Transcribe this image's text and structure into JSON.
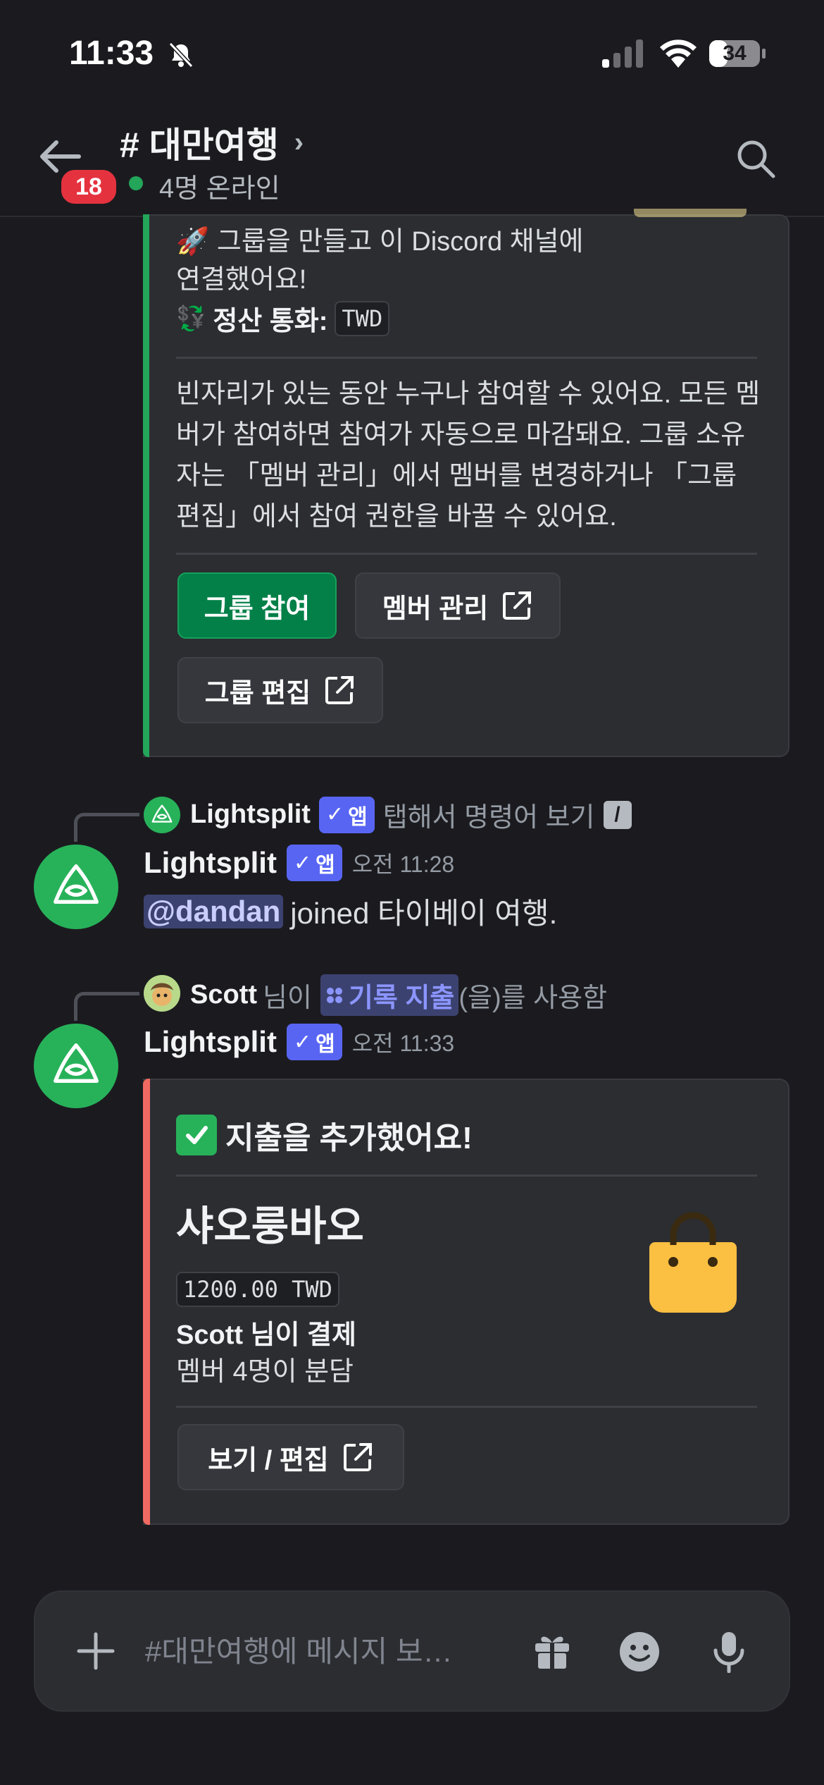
{
  "status_bar": {
    "time": "11:33",
    "battery": "34"
  },
  "header": {
    "channel_title": "# 대만여행",
    "chevron": "›",
    "unread_badge": "18",
    "online_status": "4명 온라인"
  },
  "embed_group": {
    "line1": "🚀 그룹을 만들고 이 Discord 채널에",
    "line2": "연결했어요!",
    "currency_emoji": "💱",
    "currency_label": "정산 통화:",
    "currency_value": "TWD",
    "description": "빈자리가 있는 동안 누구나 참여할 수 있어요. 모든 멤버가 참여하면 참여가 자동으로 마감돼요. 그룹 소유자는 「멤버 관리」에서 멤버를 변경하거나 「그룹 편집」에서 참여 권한을 바꿀 수 있어요.",
    "buttons": {
      "join": "그룹 참여",
      "manage": "멤버 관리",
      "edit": "그룹 편집"
    }
  },
  "message1": {
    "reply": {
      "username": "Lightsplit",
      "app_tag": "앱",
      "hint": "탭해서 명령어 보기",
      "slash": "/"
    },
    "username": "Lightsplit",
    "app_tag": "앱",
    "timestamp": "오전 11:28",
    "mention": "@dandan",
    "body": "joined 타이베이 여행."
  },
  "message2": {
    "reply": {
      "username": "Scott",
      "suffix": "님이",
      "command": "기록 지출",
      "used": "(을)를 사용함"
    },
    "username": "Lightsplit",
    "app_tag": "앱",
    "timestamp": "오전 11:33"
  },
  "embed_expense": {
    "title": "지출을 추가했어요!",
    "item": "샤오룽바오",
    "amount": "1200.00 TWD",
    "payer": "Scott 님이 결제",
    "split": "멤버 4명이 분담",
    "icon": "shopping-bag-icon",
    "button": "보기 / 편집"
  },
  "composer": {
    "placeholder": "#대만여행에 메시지 보…"
  },
  "colors": {
    "background": "#1b1b1f",
    "embed": "#2b2d31",
    "green_bar": "#23a55a",
    "red_bar": "#f16a61",
    "blurple": "#5865f2",
    "join_button": "#028048",
    "badge": "#e5323f"
  }
}
